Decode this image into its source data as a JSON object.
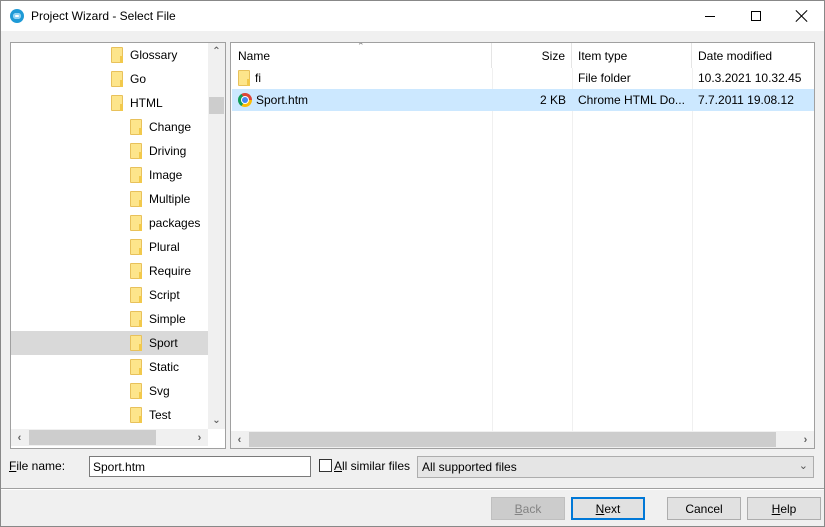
{
  "window": {
    "title": "Project Wizard - Select File",
    "controls": {
      "minimize": "minimize",
      "maximize": "maximize",
      "close": "close"
    }
  },
  "tree": {
    "items": [
      {
        "label": "Glossary",
        "level": 1,
        "selected": false
      },
      {
        "label": "Go",
        "level": 1,
        "selected": false
      },
      {
        "label": "HTML",
        "level": 1,
        "selected": false
      },
      {
        "label": "Change",
        "level": 2,
        "selected": false
      },
      {
        "label": "Driving",
        "level": 2,
        "selected": false
      },
      {
        "label": "Image",
        "level": 2,
        "selected": false
      },
      {
        "label": "Multiple",
        "level": 2,
        "selected": false
      },
      {
        "label": "packages",
        "level": 2,
        "selected": false
      },
      {
        "label": "Plural",
        "level": 2,
        "selected": false
      },
      {
        "label": "Require",
        "level": 2,
        "selected": false
      },
      {
        "label": "Script",
        "level": 2,
        "selected": false
      },
      {
        "label": "Simple",
        "level": 2,
        "selected": false
      },
      {
        "label": "Sport",
        "level": 2,
        "selected": true
      },
      {
        "label": "Static",
        "level": 2,
        "selected": false
      },
      {
        "label": "Svg",
        "level": 2,
        "selected": false
      },
      {
        "label": "Test",
        "level": 2,
        "selected": false
      }
    ]
  },
  "filelist": {
    "columns": {
      "name": "Name",
      "size": "Size",
      "type": "Item type",
      "date": "Date modified"
    },
    "sort_indicator": "^",
    "rows": [
      {
        "icon": "folder-icon",
        "name": "fi",
        "size": "",
        "type": "File folder",
        "date": "10.3.2021 10.32.45",
        "selected": false
      },
      {
        "icon": "chrome-icon",
        "name": "Sport.htm",
        "size": "2 KB",
        "type": "Chrome HTML Do...",
        "date": "7.7.2011 19.08.12",
        "selected": true
      }
    ]
  },
  "bottom": {
    "filename_label_key": "F",
    "filename_label_rest": "ile name:",
    "filename_value": "Sport.htm",
    "similar_label_key": "A",
    "similar_label_rest": "ll similar files",
    "similar_checked": false,
    "filter_value": "All supported files"
  },
  "buttons": {
    "back_key": "B",
    "back_rest": "ack",
    "next_key": "N",
    "next_rest": "ext",
    "cancel": "Cancel",
    "help_key": "H",
    "help_rest": "elp"
  },
  "colors": {
    "selection": "#cce8ff",
    "tree_selection": "#d9d9d9",
    "default_button_border": "#0078d7"
  }
}
